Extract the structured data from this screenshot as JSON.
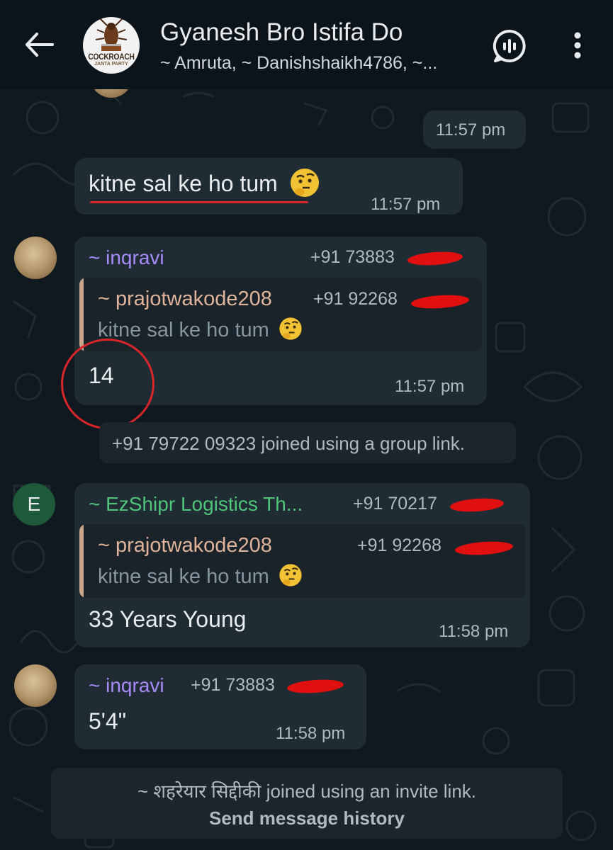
{
  "header": {
    "title": "Gyanesh Bro Istifa Do",
    "subtitle": "~ Amruta, ~ Danishshaikh4786, ~...",
    "avatar_logo_text": "COCKROACH",
    "avatar_logo_sub": "JANTA PARTY"
  },
  "messages": {
    "m1": {
      "time": "11:57 pm"
    },
    "m2": {
      "text": "kitne sal ke ho tum",
      "time": "11:57 pm"
    },
    "m3": {
      "sender": "~ inqravi",
      "phone": "+91 73883",
      "quote_name": "~ prajotwakode208",
      "quote_phone": "+91 92268",
      "quote_text": "kitne sal ke ho tum",
      "text": "14",
      "time": "11:57 pm"
    },
    "sys1": {
      "text": "+91 79722 09323 joined using a group link."
    },
    "m4": {
      "avatar_letter": "E",
      "sender": "~ EzShipr Logistics Th...",
      "phone": "+91 70217",
      "quote_name": "~ prajotwakode208",
      "quote_phone": "+91 92268",
      "quote_text": "kitne sal ke ho tum",
      "text": "33 Years Young",
      "time": "11:58 pm"
    },
    "m5": {
      "sender": "~ inqravi",
      "phone": "+91 73883",
      "text": "5'4\"",
      "time": "11:58 pm"
    },
    "sys2": {
      "text": "~ शहरेयार सिद्दीकी joined using an invite link.",
      "action": "Send message history"
    }
  },
  "colors": {
    "background": "#0b141a",
    "bubble": "#202c33",
    "sender_inqravi": "#a78bfa",
    "sender_ezshipr": "#4fc47a",
    "quote_name": "#e0b39b",
    "annotation_red": "#d9262a"
  }
}
